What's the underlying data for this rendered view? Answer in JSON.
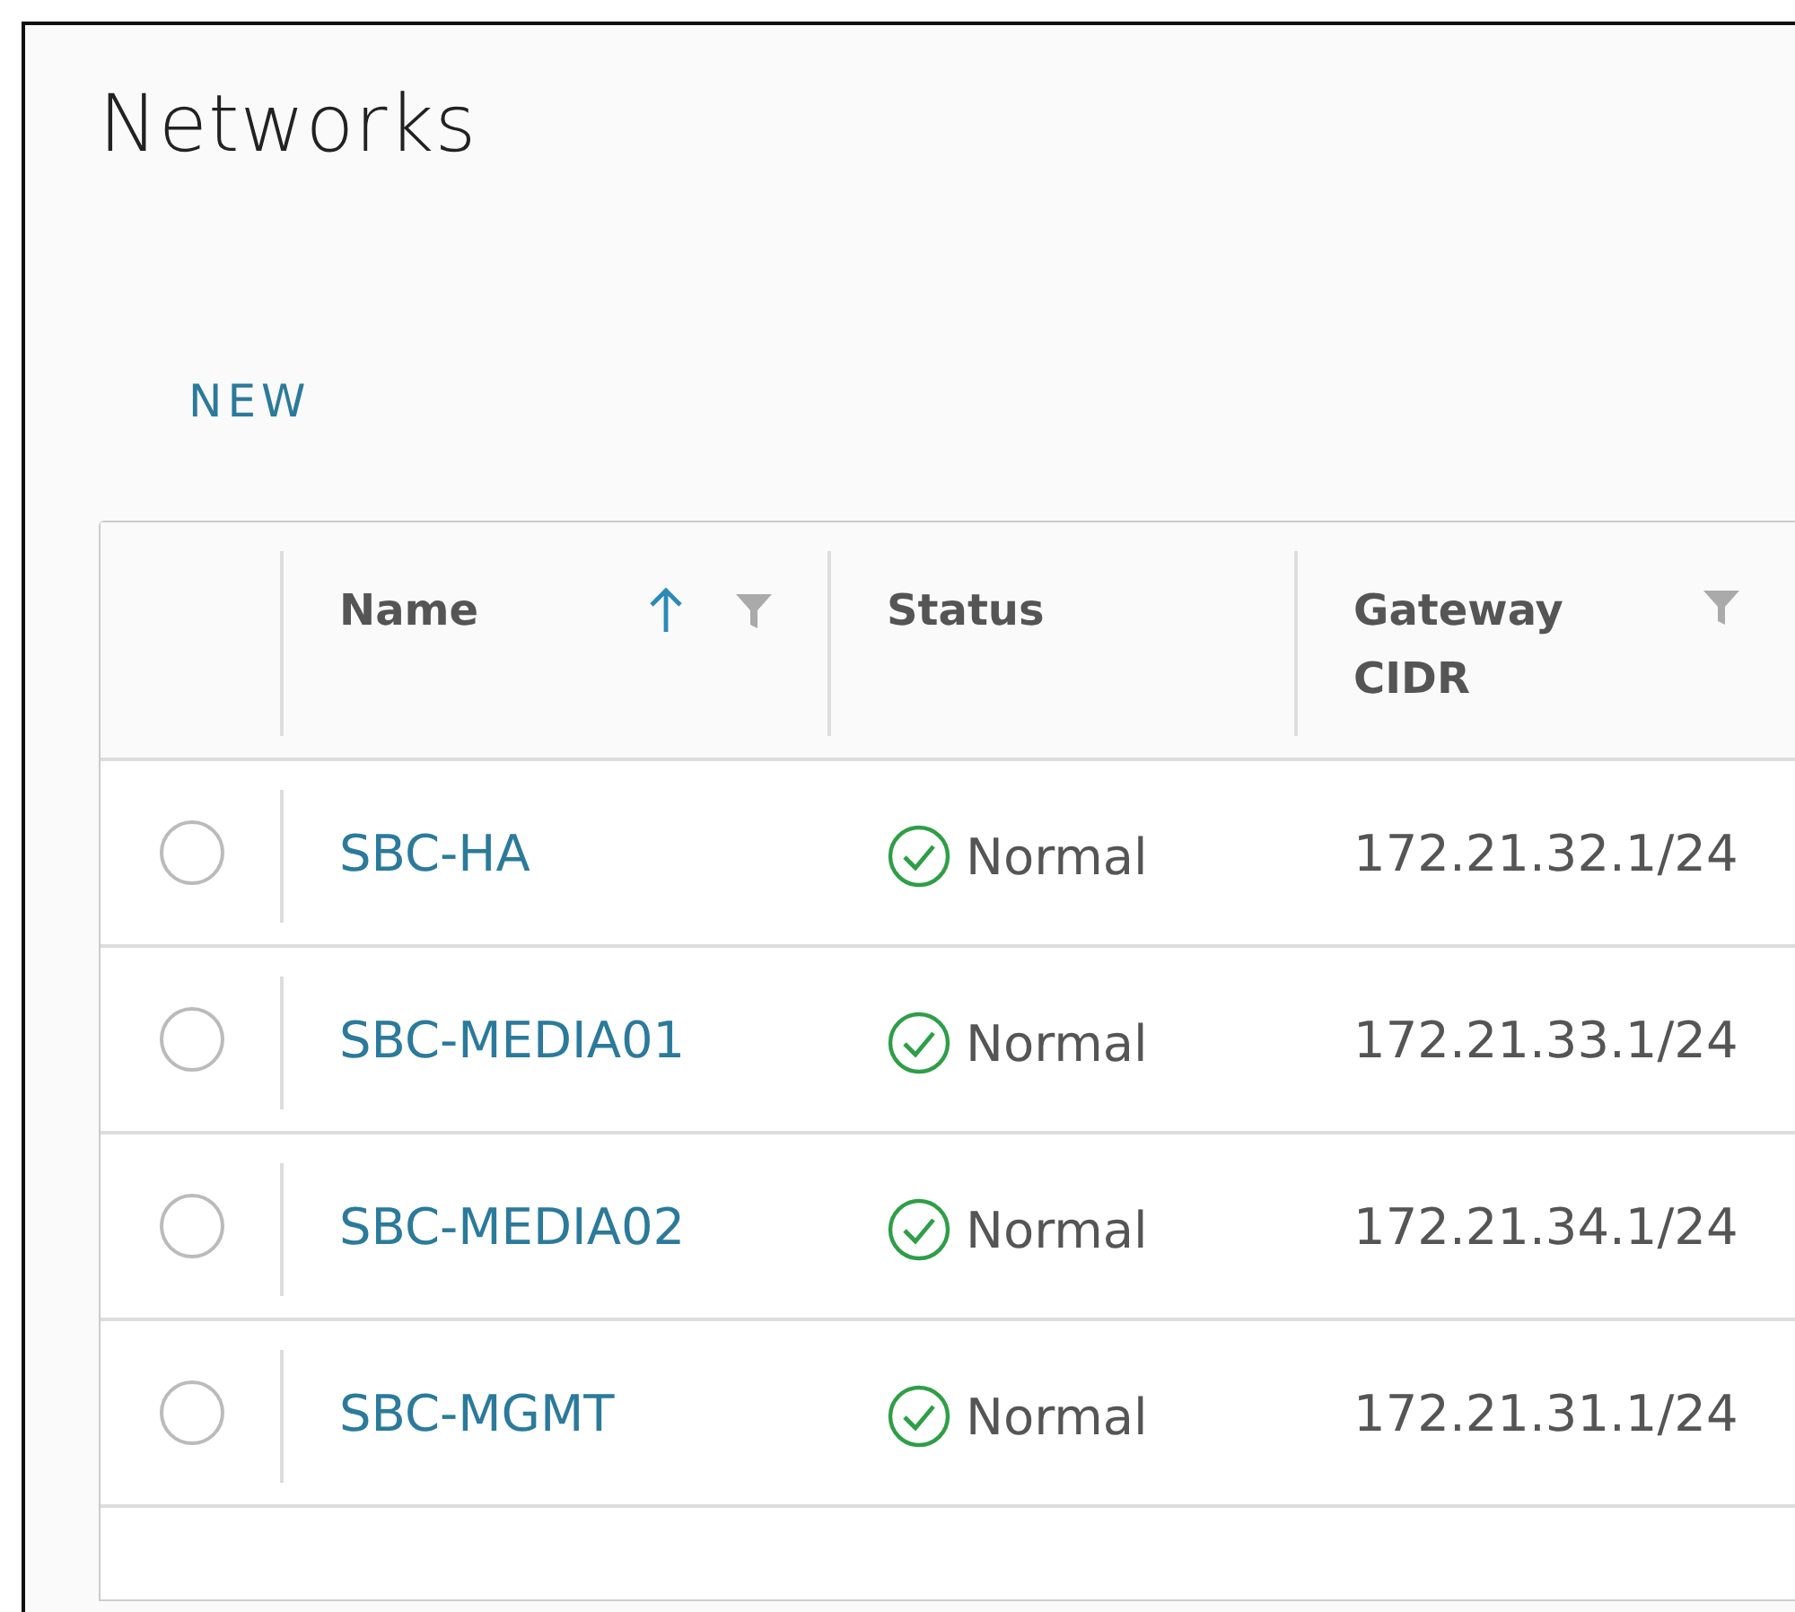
{
  "page": {
    "title": "Networks"
  },
  "toolbar": {
    "new_button": "NEW"
  },
  "table": {
    "columns": [
      {
        "label": "Name",
        "sorted_ascending": true,
        "filterable": true
      },
      {
        "label": "Status",
        "sorted_ascending": false,
        "filterable": false
      },
      {
        "label": "Gateway CIDR",
        "sorted_ascending": false,
        "filterable": true
      }
    ],
    "rows": [
      {
        "selected": false,
        "name": "SBC-HA",
        "status": "Normal",
        "kind": "ok",
        "gateway_cidr": "172.21.32.1/24"
      },
      {
        "selected": false,
        "name": "SBC-MEDIA01",
        "status": "Normal",
        "kind": "ok",
        "gateway_cidr": "172.21.33.1/24"
      },
      {
        "selected": false,
        "name": "SBC-MEDIA02",
        "status": "Normal",
        "kind": "ok",
        "gateway_cidr": "172.21.34.1/24"
      },
      {
        "selected": false,
        "name": "SBC-MGMT",
        "status": "Normal",
        "kind": "ok",
        "gateway_cidr": "172.21.31.1/24"
      }
    ]
  }
}
